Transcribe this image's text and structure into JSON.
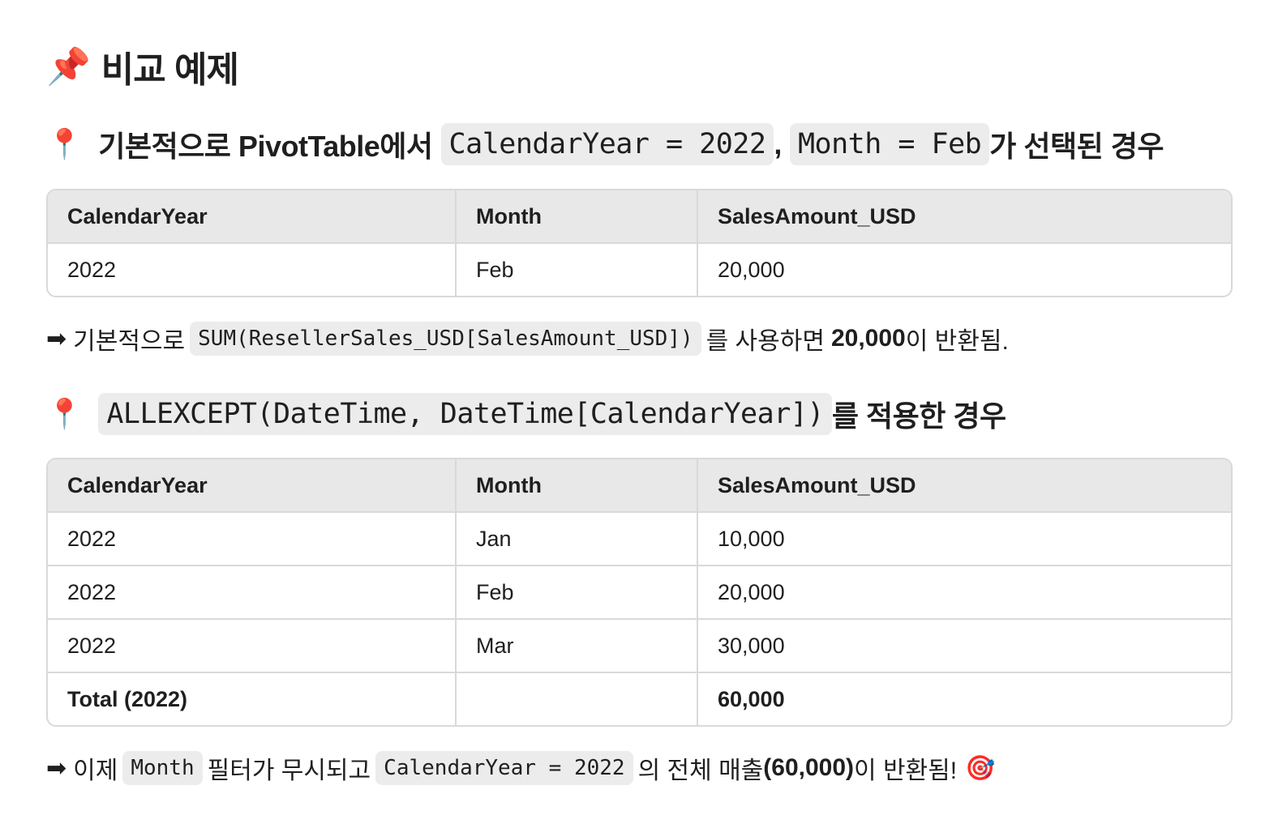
{
  "title": {
    "emoji": "📌",
    "text": "비교 예제"
  },
  "section1": {
    "emoji": "📍",
    "prefix": "기본적으로 PivotTable에서",
    "code1": "CalendarYear = 2022",
    "sep": ",",
    "code2": "Month = Feb",
    "suffix": "가 선택된 경우"
  },
  "table1": {
    "headers": [
      "CalendarYear",
      "Month",
      "SalesAmount_USD"
    ],
    "rows": [
      [
        "2022",
        "Feb",
        "20,000"
      ]
    ]
  },
  "para1": {
    "arrow": "➡",
    "prefix": "기본적으로",
    "code": "SUM(ResellerSales_USD[SalesAmount_USD])",
    "middle": "를 사용하면",
    "value": "20,000",
    "suffix": "이 반환됨."
  },
  "section2": {
    "emoji": "📍",
    "code": "ALLEXCEPT(DateTime, DateTime[CalendarYear])",
    "suffix": "를 적용한 경우"
  },
  "table2": {
    "headers": [
      "CalendarYear",
      "Month",
      "SalesAmount_USD"
    ],
    "rows": [
      [
        "2022",
        "Jan",
        "10,000"
      ],
      [
        "2022",
        "Feb",
        "20,000"
      ],
      [
        "2022",
        "Mar",
        "30,000"
      ]
    ],
    "total": [
      "Total (2022)",
      "",
      "60,000"
    ]
  },
  "para2": {
    "arrow": "➡",
    "prefix": "이제",
    "code1": "Month",
    "middle": "필터가 무시되고",
    "code2": "CalendarYear = 2022",
    "suffix": "의 전체 매출",
    "value": "(60,000)",
    "end": "이 반환됨!",
    "emoji": "🎯"
  }
}
